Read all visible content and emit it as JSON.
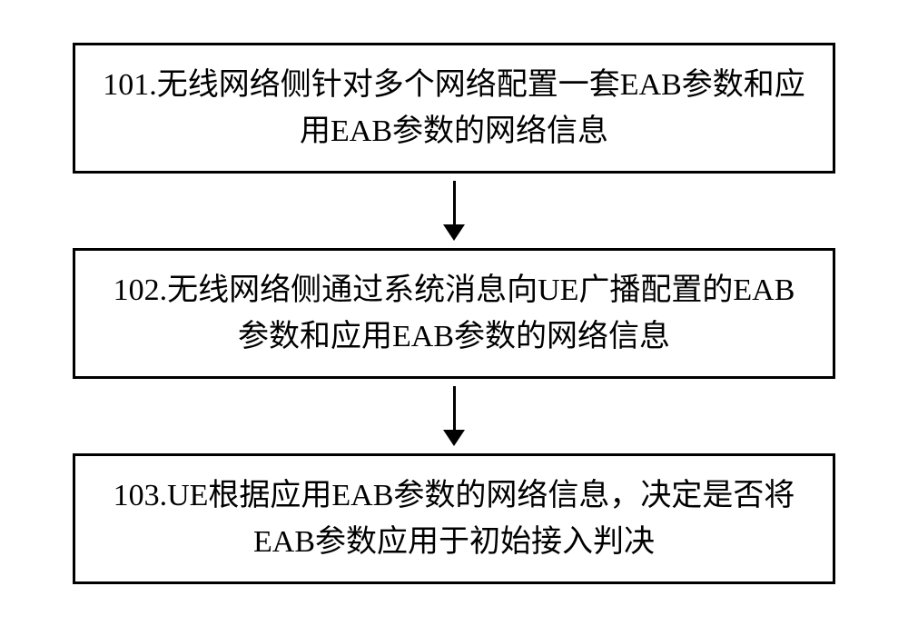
{
  "chart_data": {
    "type": "flowchart",
    "direction": "top-to-bottom",
    "nodes": [
      {
        "id": "step101",
        "number": "101",
        "text": "101.无线网络侧针对多个网络配置一套EAB参数和应用EAB参数的网络信息"
      },
      {
        "id": "step102",
        "number": "102",
        "text": "102.无线网络侧通过系统消息向UE广播配置的EAB参数和应用EAB参数的网络信息"
      },
      {
        "id": "step103",
        "number": "103",
        "text": "103.UE根据应用EAB参数的网络信息，决定是否将EAB参数应用于初始接入判决"
      }
    ],
    "edges": [
      {
        "from": "step101",
        "to": "step102"
      },
      {
        "from": "step102",
        "to": "step103"
      }
    ]
  }
}
